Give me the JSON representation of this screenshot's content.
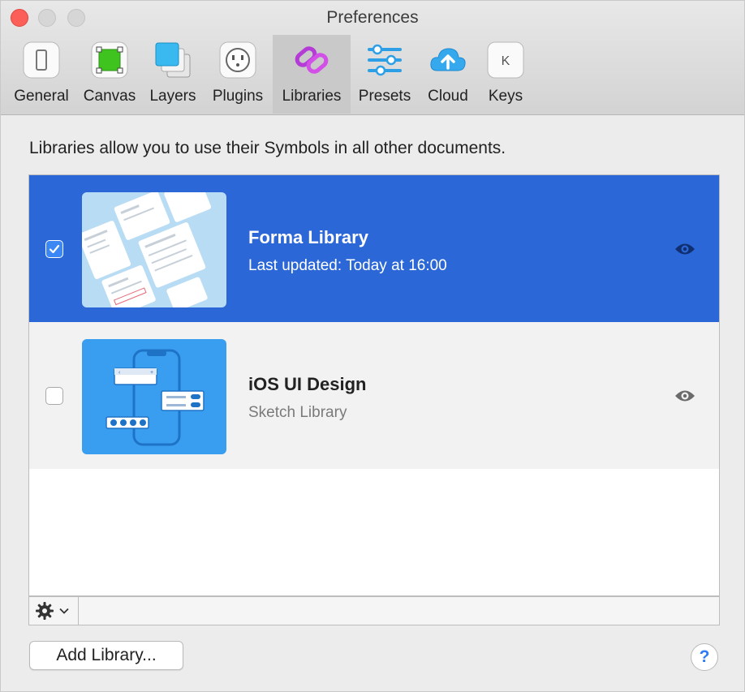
{
  "window": {
    "title": "Preferences"
  },
  "toolbar": {
    "items": [
      {
        "label": "General",
        "icon": "general-icon"
      },
      {
        "label": "Canvas",
        "icon": "canvas-icon"
      },
      {
        "label": "Layers",
        "icon": "layers-icon"
      },
      {
        "label": "Plugins",
        "icon": "plugins-icon"
      },
      {
        "label": "Libraries",
        "icon": "libraries-icon",
        "active": true
      },
      {
        "label": "Presets",
        "icon": "presets-icon"
      },
      {
        "label": "Cloud",
        "icon": "cloud-icon"
      },
      {
        "label": "Keys",
        "icon": "keys-icon",
        "glyph": "K"
      }
    ]
  },
  "content": {
    "description": "Libraries allow you to use their Symbols in all other documents."
  },
  "libraries": [
    {
      "name": "Forma Library",
      "subtitle": "Last updated: Today at 16:00",
      "checked": true,
      "selected": true
    },
    {
      "name": "iOS UI Design",
      "subtitle": "Sketch Library",
      "checked": false,
      "selected": false
    }
  ],
  "footer": {
    "add_library_label": "Add Library...",
    "help_label": "?"
  },
  "colors": {
    "selection": "#2b67d6",
    "close": "#fc5f57",
    "accent": "#2f7cf6"
  }
}
